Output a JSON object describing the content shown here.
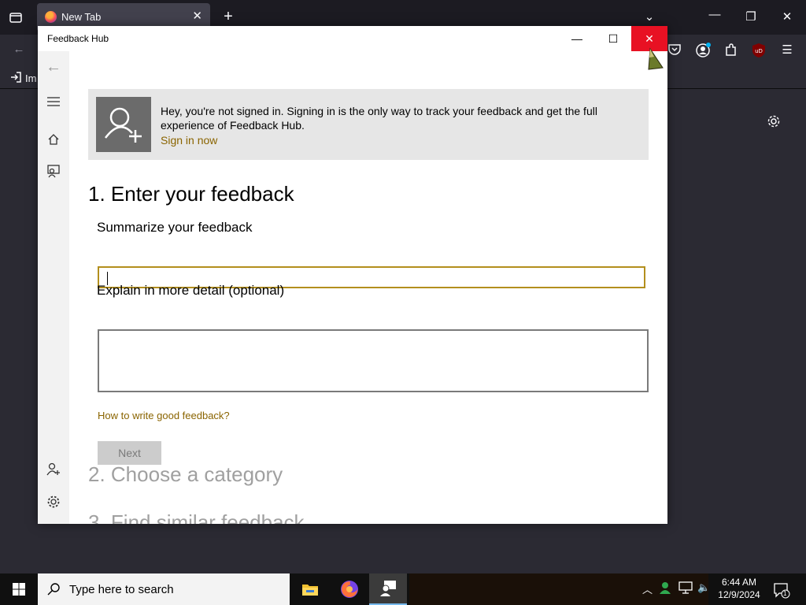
{
  "browser": {
    "tab_title": "New Tab",
    "bookmark_label": "Im",
    "new_tab_symbol": "+"
  },
  "app": {
    "title": "Feedback Hub",
    "caption_minimize": "—",
    "caption_maximize": "☐",
    "caption_close": "✕"
  },
  "banner": {
    "message": "Hey, you're not signed in. Signing in is the only way to track your feedback and get the full experience of Feedback Hub.",
    "sign_in_link": "Sign in now"
  },
  "form": {
    "step1_heading": "1. Enter your feedback",
    "summary_label": "Summarize your feedback",
    "summary_value": "",
    "detail_label": "Explain in more detail (optional)",
    "detail_value": "",
    "howto_link": "How to write good feedback?",
    "next_button": "Next",
    "step2_heading": "2. Choose a category",
    "step3_heading": "3. Find similar feedback"
  },
  "taskbar": {
    "search_placeholder": "Type here to search",
    "time": "6:44 AM",
    "date": "12/9/2024",
    "notification_count": "1"
  },
  "icons": {
    "rail": [
      "back-arrow-icon",
      "hamburger-menu-icon",
      "home-icon",
      "feedback-icon",
      "add-user-icon",
      "settings-icon"
    ],
    "accent_color": "#8a6400",
    "close_color": "#e81123"
  }
}
